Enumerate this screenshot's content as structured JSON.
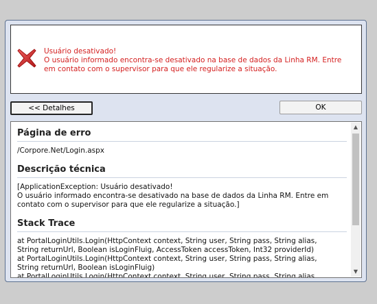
{
  "message": {
    "title": "Usuário desativado!",
    "line1": "O usuário informado encontra-se desativado na base de dados da Linha RM. Entre",
    "line2": "em contato com o supervisor para que ele regularize a situação."
  },
  "buttons": {
    "details_label": "<< Detalhes",
    "ok_label": "OK"
  },
  "details": {
    "page_title": "Página de erro",
    "page_path": "/Corpore.Net/Login.aspx",
    "tech_title": "Descrição técnica",
    "tech_lines": [
      "[ApplicationException: Usuário desativado!",
      "O usuário informado encontra-se desativado na base de dados da Linha RM. Entre em",
      "contato com o supervisor para que ele regularize a situação.]"
    ],
    "stack_title": "Stack Trace",
    "stack_lines": [
      "at PortalLoginUtils.Login(HttpContext context, String user, String pass, String alias,",
      "String returnUrl, Boolean isLoginFluig, AccessToken accessToken, Int32 providerId)",
      "at PortalLoginUtils.Login(HttpContext context, String user, String pass, String alias,",
      "String returnUrl, Boolean isLoginFluig)",
      "at PortalLoginUtils.Login(HttpContext context, String user, String pass, String alias,"
    ]
  },
  "colors": {
    "error_text": "#d42020",
    "dialog_bg": "#dde3f0"
  },
  "icons": {
    "error": "red-x-icon",
    "scroll_up": "scroll-up-arrow-icon",
    "scroll_down": "scroll-down-arrow-icon"
  }
}
